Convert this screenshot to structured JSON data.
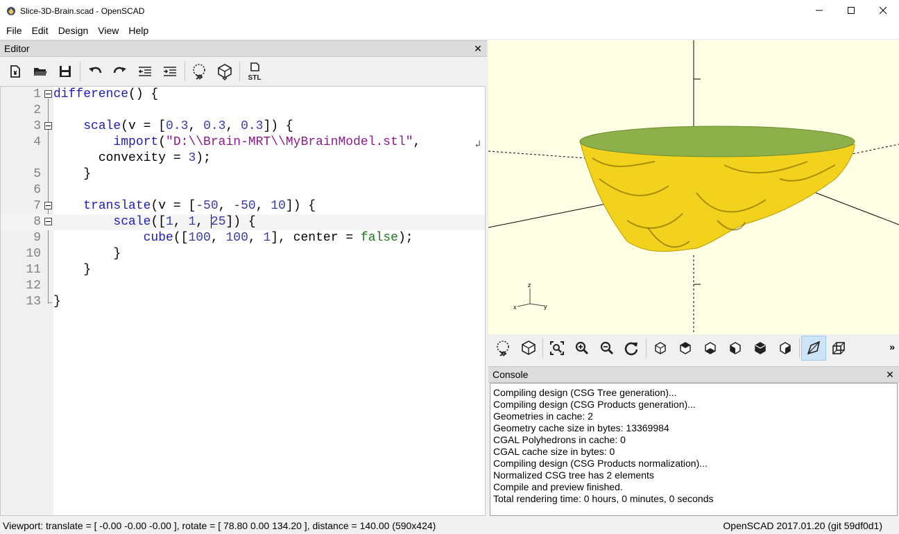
{
  "window": {
    "title": "Slice-3D-Brain.scad - OpenSCAD"
  },
  "menu": [
    "File",
    "Edit",
    "Design",
    "View",
    "Help"
  ],
  "editor": {
    "title": "Editor",
    "close": "✕",
    "toolbar": [
      "new-file",
      "open-file",
      "save-file",
      "undo",
      "redo",
      "unindent",
      "indent",
      "preview",
      "render",
      "export-stl"
    ],
    "stl_label": "STL",
    "lines": [
      {
        "n": "1"
      },
      {
        "n": "2"
      },
      {
        "n": "3"
      },
      {
        "n": "4"
      },
      {
        "n": ""
      },
      {
        "n": "5"
      },
      {
        "n": "6"
      },
      {
        "n": "7"
      },
      {
        "n": "8"
      },
      {
        "n": "9"
      },
      {
        "n": "10"
      },
      {
        "n": "11"
      },
      {
        "n": "12"
      },
      {
        "n": "13"
      }
    ],
    "code": {
      "l1_fn": "difference",
      "l1_rest": "() {",
      "l3_fn": "scale",
      "l3_a": "(v = [",
      "l3_n1": "0.3",
      "l3_n2": "0.3",
      "l3_n3": "0.3",
      "l3_b": "]) {",
      "l4_fn": "import",
      "l4_str": "\"D:\\\\Brain-MRT\\\\MyBrainModel.stl\"",
      "l4_rest": ",",
      "l4b_text": " convexity = ",
      "l4b_num": "3",
      "l4b_end": ");",
      "l5": "}",
      "l7_fn": "translate",
      "l7_a": "(v = [",
      "l7_n1": "-50",
      "l7_n2": "-50",
      "l7_n3": "10",
      "l7_b": "]) {",
      "l8_fn": "scale",
      "l8_a": "([",
      "l8_n1": "1",
      "l8_n2": "1",
      "l8_n3": "25",
      "l8_b": "]) {",
      "l9_fn": "cube",
      "l9_a": "([",
      "l9_n1": "100",
      "l9_n2": "100",
      "l9_n3": "1",
      "l9_b": "], center = ",
      "l9_bool": "false",
      "l9_end": ");",
      "l10": "}",
      "l11": "}",
      "l13": "}",
      "comma": ", "
    }
  },
  "viewport": {
    "axis_labels": {
      "x": "x",
      "y": "y",
      "z": "z"
    },
    "colors": {
      "background": "#ffffe5",
      "model": "#f2d21c",
      "cut": "#8db04a"
    }
  },
  "view_toolbar": [
    "preview",
    "render",
    "view-all",
    "zoom-in",
    "zoom-out",
    "reset-view",
    "view-right",
    "view-top",
    "view-bottom",
    "view-left",
    "view-front",
    "view-back",
    "perspective",
    "orthogonal"
  ],
  "view_more": "»",
  "console": {
    "title": "Console",
    "close": "✕",
    "lines": [
      "Compiling design (CSG Tree generation)...",
      "Compiling design (CSG Products generation)...",
      "Geometries in cache: 2",
      "Geometry cache size in bytes: 13369984",
      "CGAL Polyhedrons in cache: 0",
      "CGAL cache size in bytes: 0",
      "Compiling design (CSG Products normalization)...",
      "Normalized CSG tree has 2 elements",
      "Compile and preview finished.",
      "Total rendering time: 0 hours, 0 minutes, 0 seconds"
    ]
  },
  "status": {
    "left": "Viewport: translate = [ -0.00 -0.00 -0.00 ], rotate = [ 78.80 0.00 134.20 ], distance = 140.00 (590x424)",
    "right": "OpenSCAD 2017.01.20 (git 59df0d1)"
  }
}
